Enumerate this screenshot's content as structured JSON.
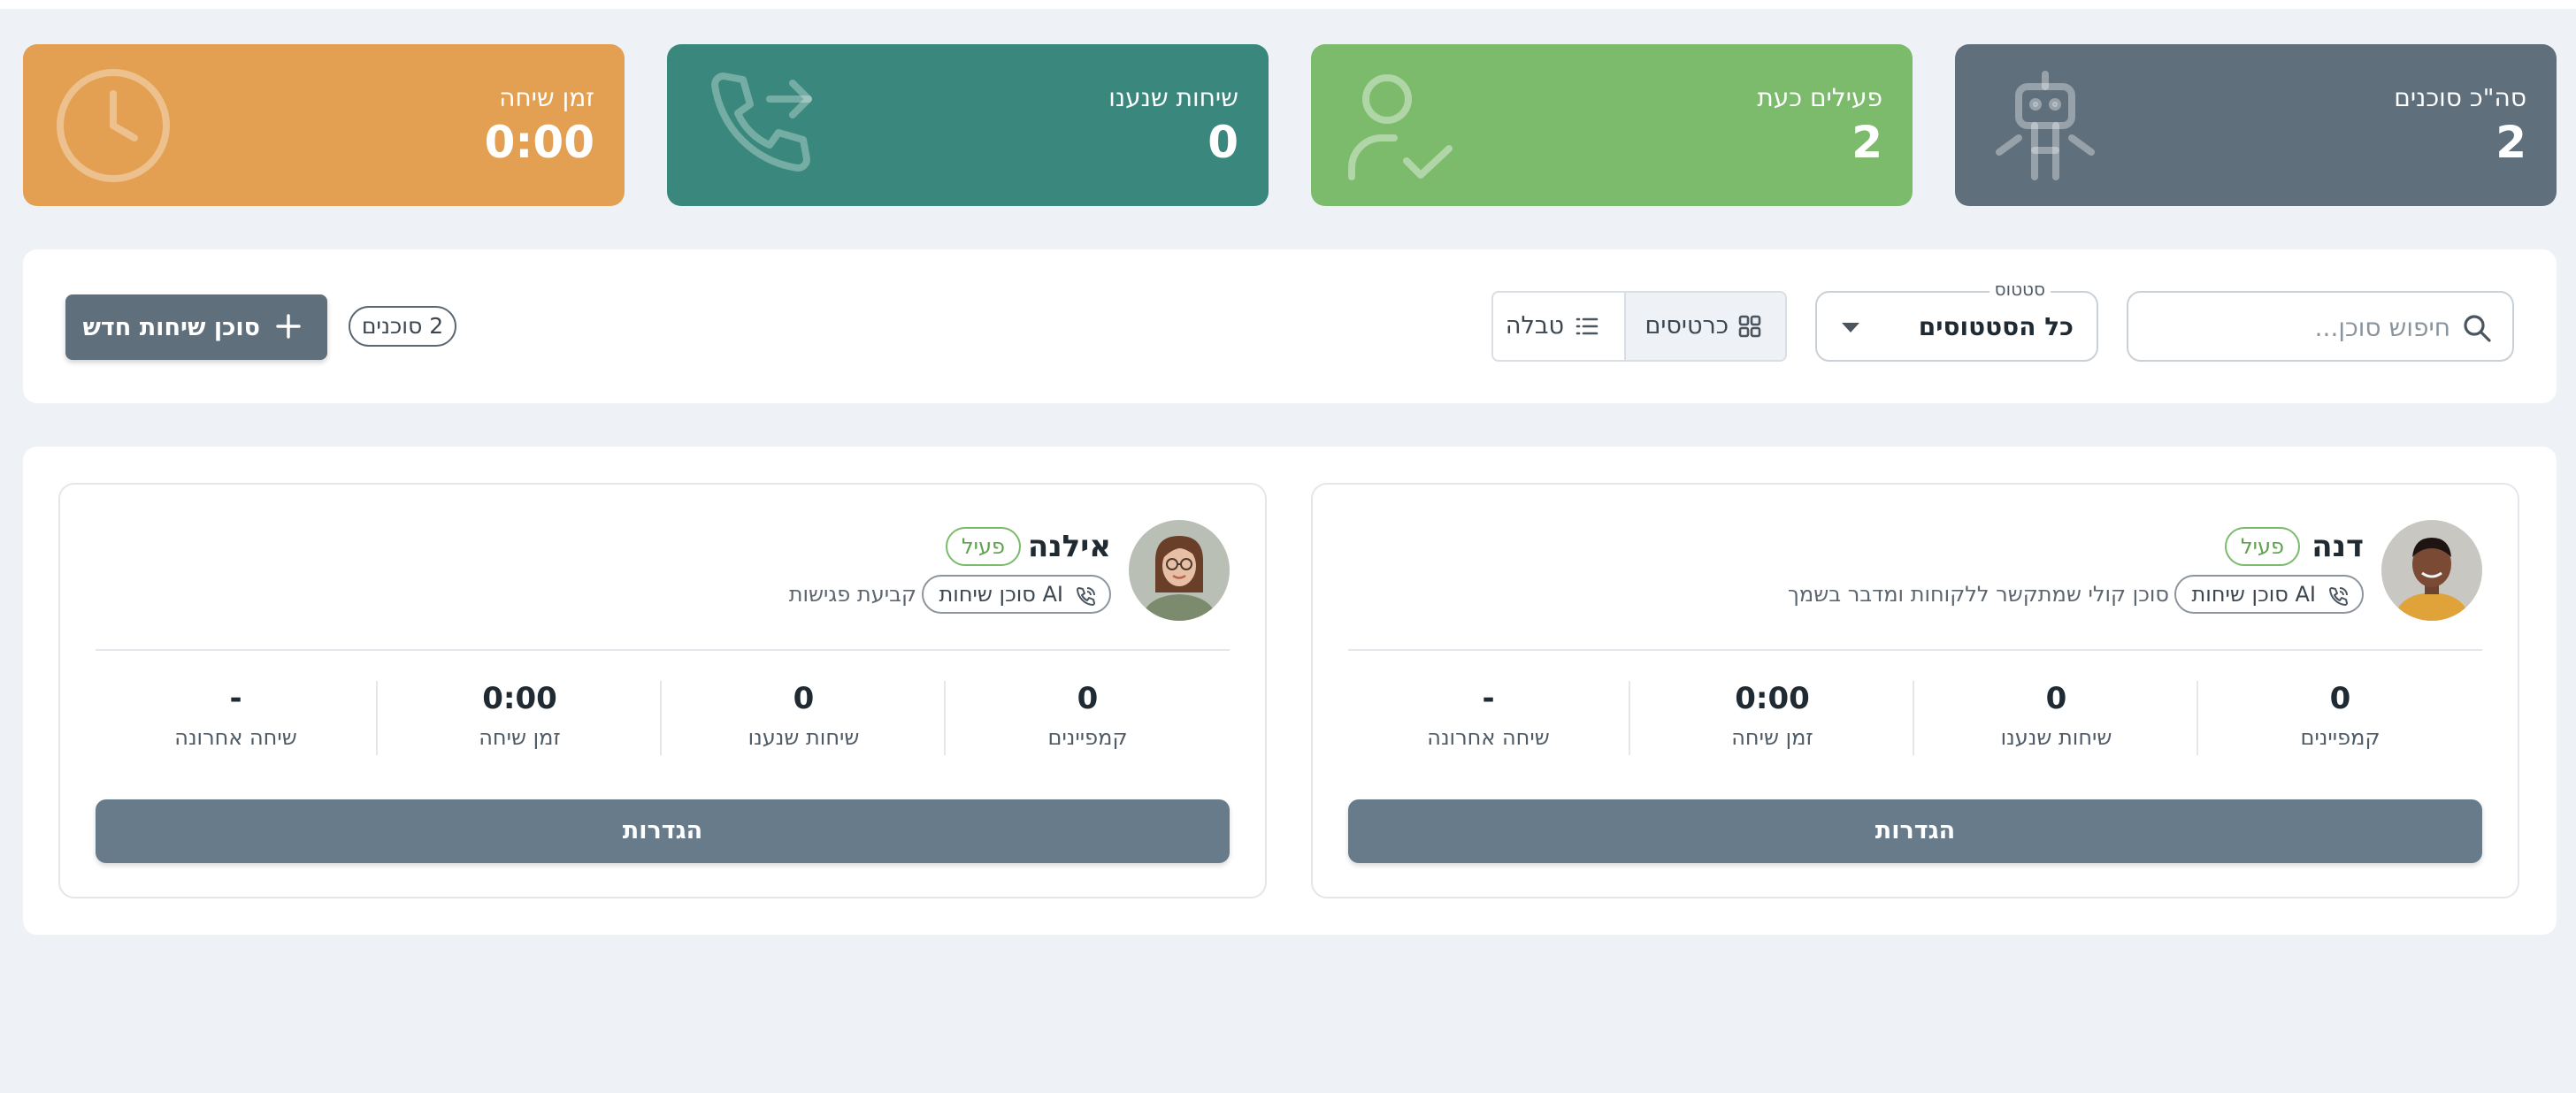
{
  "stats": {
    "total_agents": {
      "label": "סה\"כ סוכנים",
      "value": "2",
      "icon": "robot-icon",
      "color": "#5f6f7c"
    },
    "active_now": {
      "label": "פעילים כעת",
      "value": "2",
      "icon": "user-check-icon",
      "color": "#7cba6c"
    },
    "answered_calls": {
      "label": "שיחות שנענו",
      "value": "0",
      "icon": "phone-forward-icon",
      "color": "#3a887d"
    },
    "talk_time": {
      "label": "זמן שיחה",
      "value": "0:00",
      "icon": "clock-icon",
      "color": "#e3a052"
    }
  },
  "toolbar": {
    "search_placeholder": "חיפוש סוכן...",
    "status_legend": "סטטוס",
    "status_value": "כל הסטטוסים",
    "view_cards": "כרטיסים",
    "view_table": "טבלה",
    "agent_count": "2 סוכנים",
    "new_agent": "סוכן שיחות חדש"
  },
  "agents": [
    {
      "name": "דנה",
      "status": "פעיל",
      "type": "סוכן שיחות AI",
      "description": "סוכן קולי שמתקשר ללקוחות ומדבר בשמך",
      "stats": [
        {
          "value": "0",
          "label": "קמפיינים"
        },
        {
          "value": "0",
          "label": "שיחות שנענו"
        },
        {
          "value": "0:00",
          "label": "זמן שיחה"
        },
        {
          "value": "-",
          "label": "שיחה אחרונה"
        }
      ],
      "settings": "הגדרות"
    },
    {
      "name": "אילנה",
      "status": "פעיל",
      "type": "סוכן שיחות AI",
      "description": "קביעת פגישות",
      "stats": [
        {
          "value": "0",
          "label": "קמפיינים"
        },
        {
          "value": "0",
          "label": "שיחות שנענו"
        },
        {
          "value": "0:00",
          "label": "זמן שיחה"
        },
        {
          "value": "-",
          "label": "שיחה אחרונה"
        }
      ],
      "settings": "הגדרות"
    }
  ]
}
